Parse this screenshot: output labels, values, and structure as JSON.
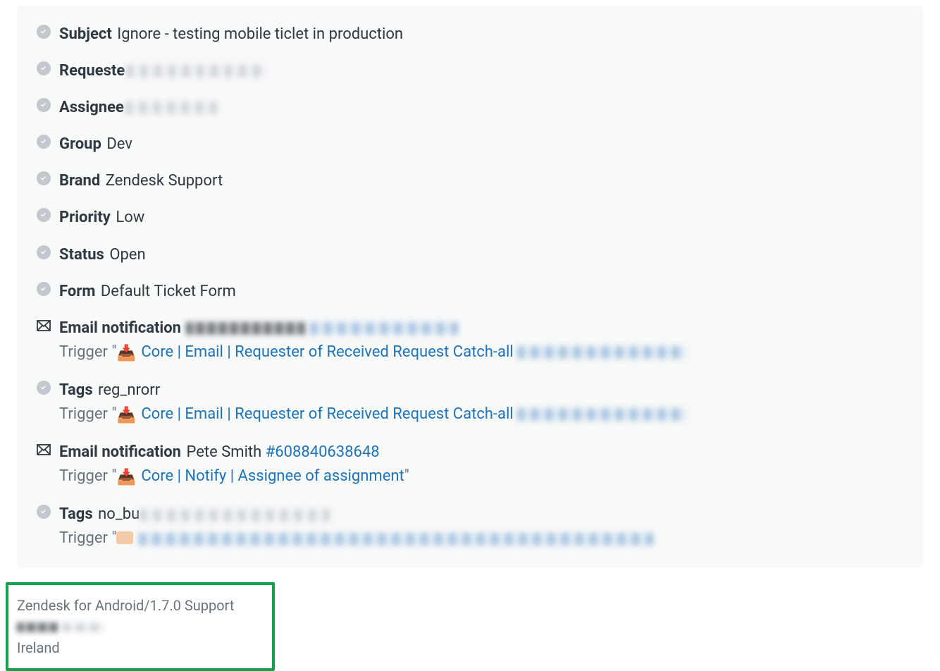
{
  "fields": {
    "subject": {
      "label": "Subject",
      "value": "Ignore - testing mobile ticlet in production"
    },
    "requester": {
      "label": "Requeste"
    },
    "assignee": {
      "label": "Assignee"
    },
    "group": {
      "label": "Group",
      "value": "Dev"
    },
    "brand": {
      "label": "Brand",
      "value": "Zendesk Support"
    },
    "priority": {
      "label": "Priority",
      "value": "Low"
    },
    "status": {
      "label": "Status",
      "value": "Open"
    },
    "form": {
      "label": "Form",
      "value": "Default Ticket Form"
    }
  },
  "notif1": {
    "label": "Email notification",
    "trigger_prefix": "Trigger \"",
    "trigger_link": " Core | Email | Requester of Received Request Catch-all"
  },
  "tags1": {
    "label": "Tags",
    "value": "reg_nrorr",
    "trigger_prefix": "Trigger \"",
    "trigger_link": " Core | Email | Requester of Received Request Catch-all"
  },
  "notif2": {
    "label": "Email notification",
    "recipient": "Pete Smith",
    "ticket_id": "#608840638648",
    "trigger_prefix": "Trigger \"",
    "trigger_link": " Core | Notify | Assignee of assignment",
    "trigger_suffix": "\""
  },
  "tags2": {
    "label": "Tags",
    "value_partial": "no_bu",
    "trigger_prefix": "Trigger \""
  },
  "footer": {
    "line1": "Zendesk for Android/1.7.0 Support",
    "line3": "Ireland"
  }
}
